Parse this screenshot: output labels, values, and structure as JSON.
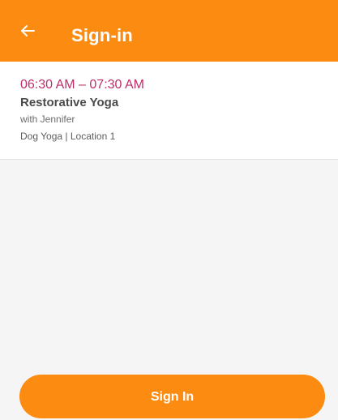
{
  "header": {
    "title": "Sign-in",
    "back_icon": "arrow-left-icon",
    "background_color": "#fb8b11"
  },
  "session": {
    "time_range": "06:30 AM – 07:30 AM",
    "class_name": "Restorative Yoga",
    "instructor": "with Jennifer",
    "studio": "Dog Yoga",
    "separator": "|",
    "location": "Location 1",
    "time_color": "#be2f6a"
  },
  "footer": {
    "signin_label": "Sign In",
    "button_color": "#fb8b11"
  }
}
